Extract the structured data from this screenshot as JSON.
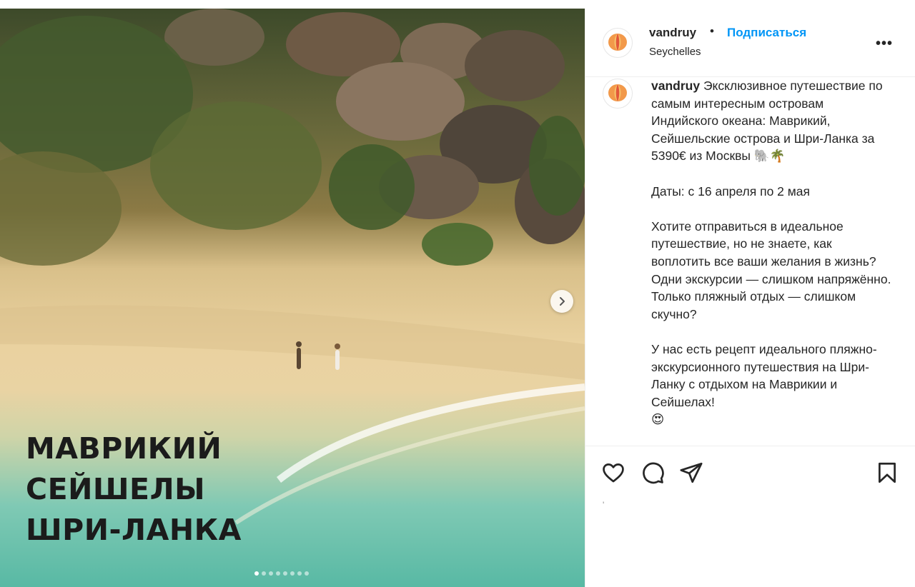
{
  "post": {
    "image": {
      "overlay_lines": [
        "МАВРИКИЙ",
        "СЕЙШЕЛЫ",
        "ШРИ-ЛАНКА"
      ],
      "carousel": {
        "total": 8,
        "active": 1
      }
    },
    "header": {
      "username": "vandruy",
      "separator": "•",
      "follow_label": "Подписаться",
      "location": "Seychelles",
      "more_label": "•••"
    },
    "caption": {
      "username": "vandruy",
      "intro": "Эксклюзивное путешествие по самым интересным островам Индийского океана: Маврикий, Сейшельские острова и Шри-Ланка за 5390€ из Москвы 🐘🌴",
      "dates": "Даты: с 16 апреля по 2 мая",
      "paragraph2": "Хотите отправиться в идеальное путешествие, но не знаете, как воплотить все ваши желания в жизнь? Одни экскурсии — слишком напряжённо. Только пляжный отдых — слишком скучно?",
      "paragraph3": "У нас есть рецепт идеального пляжно-экскурсионного путешествия на Шри-Ланку с отдыхом на Маврикии и Сейшелах!",
      "emoji_line": "😍"
    },
    "likes_text": "'",
    "colors": {
      "follow": "#0095f6",
      "text": "#262626",
      "border": "#efefef"
    }
  }
}
